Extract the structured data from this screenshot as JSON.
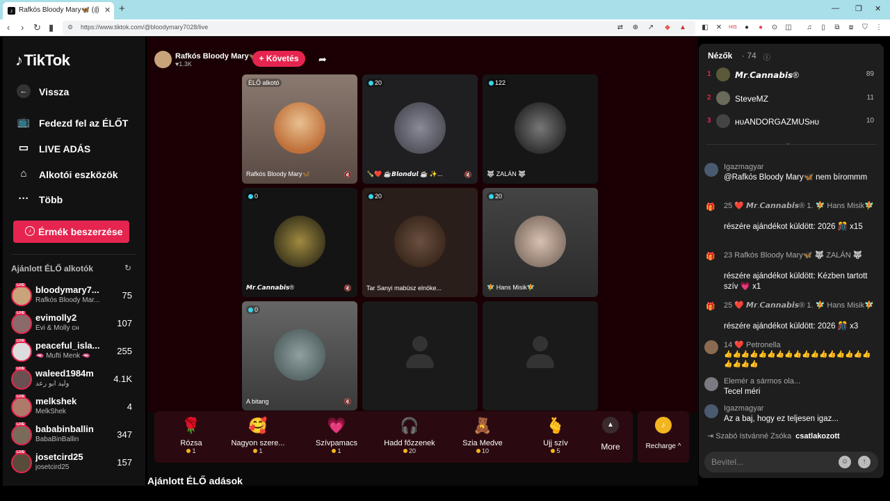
{
  "browser": {
    "tab_title": "Rafkós Bloody Mary🦋 (@blo",
    "url": "https://www.tiktok.com/@bloodymary7028/live"
  },
  "sidebar": {
    "logo": "TikTok",
    "nav": [
      {
        "label": "Vissza",
        "icon": "arrow-left-icon"
      },
      {
        "label": "Fedezd fel az ÉLŐT",
        "icon": "tv-icon"
      },
      {
        "label": "LIVE ADÁS",
        "icon": "video-camera-icon"
      },
      {
        "label": "Alkotói eszközök",
        "icon": "creator-tools-icon"
      },
      {
        "label": "Több",
        "icon": "more-dots-icon"
      }
    ],
    "coins_button": "Érmék beszerzése",
    "recommended_title": "Ajánlott ÉLŐ alkotók",
    "live_badge": "LIVE",
    "recommended": [
      {
        "name": "bloodymary7...",
        "sub": "Rafkós Bloody Mar...",
        "count": "75"
      },
      {
        "name": "evimolly2",
        "sub": "Évi & Molly ᴄʜ",
        "count": "107"
      },
      {
        "name": "peaceful_isla...",
        "sub": "🫦 Mufti Menk 🫦",
        "count": "255"
      },
      {
        "name": "waleed1984m",
        "sub": "وليد ابو رعد",
        "count": "4.1K"
      },
      {
        "name": "melkshek",
        "sub": "MelkShek",
        "count": "4"
      },
      {
        "name": "bababinballin",
        "sub": "BabaBinBallin",
        "count": "347"
      },
      {
        "name": "josetcird25",
        "sub": "josetcird25",
        "count": "157"
      }
    ]
  },
  "host": {
    "name": "Rafkós Bloody Mary🦋",
    "likes": "♥1.3K",
    "follow_label": "+ Követés"
  },
  "tiles": [
    {
      "count": "ÉLŐ alkotó",
      "name": "Rafkós Bloody Mary🦋",
      "muted": true
    },
    {
      "count": "20",
      "name": "🍾❤️ ☕𝘽𝙡𝙤𝙣𝙙𝙪𝙡 ☕ ✨...",
      "muted": true
    },
    {
      "count": "122",
      "name": "🐺 ZALÁN 🐺",
      "muted": false
    },
    {
      "count": "0",
      "name": "𝙈𝙧.𝘾𝙖𝙣𝙣𝙖𝙗𝙞𝙨®",
      "muted": true
    },
    {
      "count": "20",
      "name": "Tar Sanyi mabüsz elnöke...",
      "muted": false
    },
    {
      "count": "20",
      "name": "🧚 Hans Misik🧚",
      "muted": false
    },
    {
      "count": "0",
      "name": "A bitang",
      "muted": true
    },
    {
      "count": "",
      "name": "",
      "muted": false
    },
    {
      "count": "",
      "name": "",
      "muted": false
    }
  ],
  "gifts": [
    {
      "name": "Rózsa",
      "price": "1",
      "icon": "🌹"
    },
    {
      "name": "Nagyon szere...",
      "price": "1",
      "icon": "🥰"
    },
    {
      "name": "Szívpamacs",
      "price": "1",
      "icon": "💗"
    },
    {
      "name": "Hadd főzzenek",
      "price": "20",
      "icon": "🎧"
    },
    {
      "name": "Szia Medve",
      "price": "10",
      "icon": "🧸"
    },
    {
      "name": "Ujj szív",
      "price": "5",
      "icon": "🫰"
    }
  ],
  "more_label": "More",
  "recharge_label": "Recharge ^",
  "more_lives_title": "Ajánlott ÉLŐ adások",
  "viewers": {
    "title": "Nézők",
    "count": "· 74",
    "list": [
      {
        "rank": "1",
        "name": "𝙈𝙧.𝘾𝙖𝙣𝙣𝙖𝙗𝙞𝙨®",
        "score": "89"
      },
      {
        "rank": "2",
        "name": "SteveMZ",
        "score": "11"
      },
      {
        "rank": "3",
        "name": "ʜᴜANDORGAZMUSʜᴜ",
        "score": "10"
      }
    ]
  },
  "chat": [
    {
      "name": "Igazmagyar",
      "text": "@Rafkós Bloody Mary🦋 nem bírommm",
      "gift": false
    },
    {
      "name": "25 ❤️ 𝙈𝙧.𝘾𝙖𝙣𝙣𝙖𝙗𝙞𝙨® 1. 🧚 Hans Misik🧚",
      "text": "részére ajándékot küldött: 2026 🎊 x15",
      "gift": true
    },
    {
      "name": "23 Rafkós Bloody Mary🦋 🐺 ZALÁN 🐺",
      "text": "részére ajándékot küldött: Kézben tartott szív 💗 x1",
      "gift": true
    },
    {
      "name": "25 ❤️ 𝙈𝙧.𝘾𝙖𝙣𝙣𝙖𝙗𝙞𝙨® 1. 🧚 Hans Misik🧚",
      "text": "részére ajándékot küldött: 2026 🎊 x3",
      "gift": true
    },
    {
      "name": "14 ❤️ Petronella",
      "text": "👍👍👍👍👍👍👍👍👍👍👍👍👍👍👍👍👍👍👍👍👍",
      "gift": false
    },
    {
      "name": "Elemér a sármos ola...",
      "text": "Tecel méri",
      "gift": false
    },
    {
      "name": "Igazmagyar",
      "text": "Az a baj, hogy ez teljesen igaz...",
      "gift": false
    }
  ],
  "joined": {
    "name": "Szabó Istvánné Zsóka",
    "action": "csatlakozott"
  },
  "input_placeholder": "Bevitel..."
}
